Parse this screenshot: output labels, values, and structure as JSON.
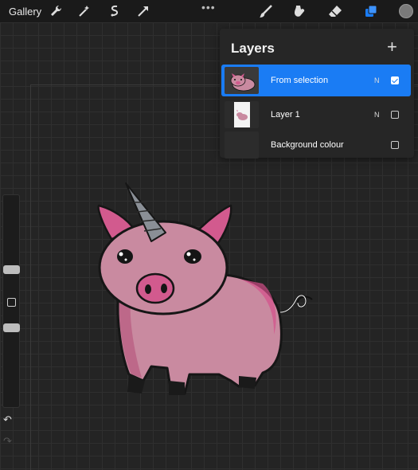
{
  "topbar": {
    "gallery_label": "Gallery",
    "more_label": "•••",
    "tools": [
      "wrench-icon",
      "magic-wand-icon",
      "selection-icon",
      "transform-icon",
      "brush-icon",
      "smudge-icon",
      "eraser-icon",
      "layers-icon"
    ],
    "active_color": "#7a7a7a"
  },
  "layers_panel": {
    "title": "Layers",
    "add_label": "+",
    "layers": [
      {
        "name": "From selection",
        "blend": "N",
        "visible": true,
        "selected": true
      },
      {
        "name": "Layer 1",
        "blend": "N",
        "visible": false,
        "selected": false
      },
      {
        "name": "Background colour",
        "blend": "",
        "visible": false,
        "selected": false
      }
    ]
  },
  "sidebar": {
    "undo_label": "↶",
    "redo_label": "↷"
  },
  "colors": {
    "accent": "#1a7cf4",
    "pig_body": "#c98aa0",
    "pig_ear": "#d25a8e"
  }
}
